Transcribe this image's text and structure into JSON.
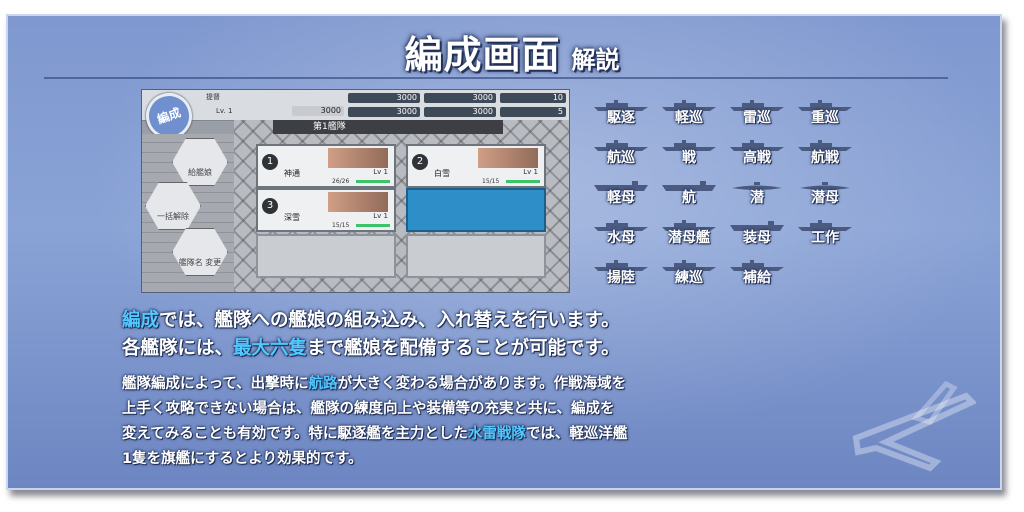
{
  "title": {
    "main": "編成画面",
    "sub": "解説"
  },
  "screenshot": {
    "hud": {
      "rank_label": "提督",
      "level": "Lv. 1",
      "exp": "3000",
      "resources": [
        "3000",
        "3000",
        "10",
        "3000",
        "3000",
        "5"
      ]
    },
    "emblem": "編成",
    "fleet_name": "第1艦隊",
    "side_buttons": [
      "給艦娘",
      "一括解除",
      "艦隊名\n変更"
    ],
    "cards": [
      {
        "num": "1",
        "name": "神通",
        "level": "Lv 1",
        "hp": "26/26"
      },
      {
        "num": "2",
        "name": "白雪",
        "level": "Lv 1",
        "hp": "15/15"
      },
      {
        "num": "3",
        "name": "深雪",
        "level": "Lv 1",
        "hp": "15/15"
      }
    ]
  },
  "ship_types": [
    [
      "駆逐",
      "軽巡",
      "雷巡",
      "重巡"
    ],
    [
      "航巡",
      "戦",
      "高戦",
      "航戦"
    ],
    [
      "軽母",
      "航",
      "潜",
      "潜母"
    ],
    [
      "水母",
      "潜母艦",
      "装母",
      "工作"
    ],
    [
      "揚陸",
      "練巡",
      "補給"
    ]
  ],
  "body": {
    "line1": {
      "hl": "編成",
      "rest": "では、艦隊への艦娘の組み込み、入れ替えを行います。"
    },
    "line2": {
      "pre": "各艦隊には、",
      "hl": "最大六隻",
      "post": "まで艦娘を配備することが可能です。"
    },
    "para": {
      "a1": "艦隊編成によって、出撃時に",
      "a_hl": "航路",
      "a2": "が大きく変わる場合があります。作戦海域を",
      "b": "上手く攻略できない場合は、艦隊の練度向上や装備等の充実と共に、編成を",
      "c1": "変えてみることも有効です。特に駆逐艦を主力とした",
      "c_hl": "水雷戦隊",
      "c2": "では、軽巡洋艦",
      "d": "1隻を旗艦にするとより効果的です。"
    }
  },
  "colors": {
    "highlight": "#52c8ff",
    "panel": "#7f98cf"
  }
}
